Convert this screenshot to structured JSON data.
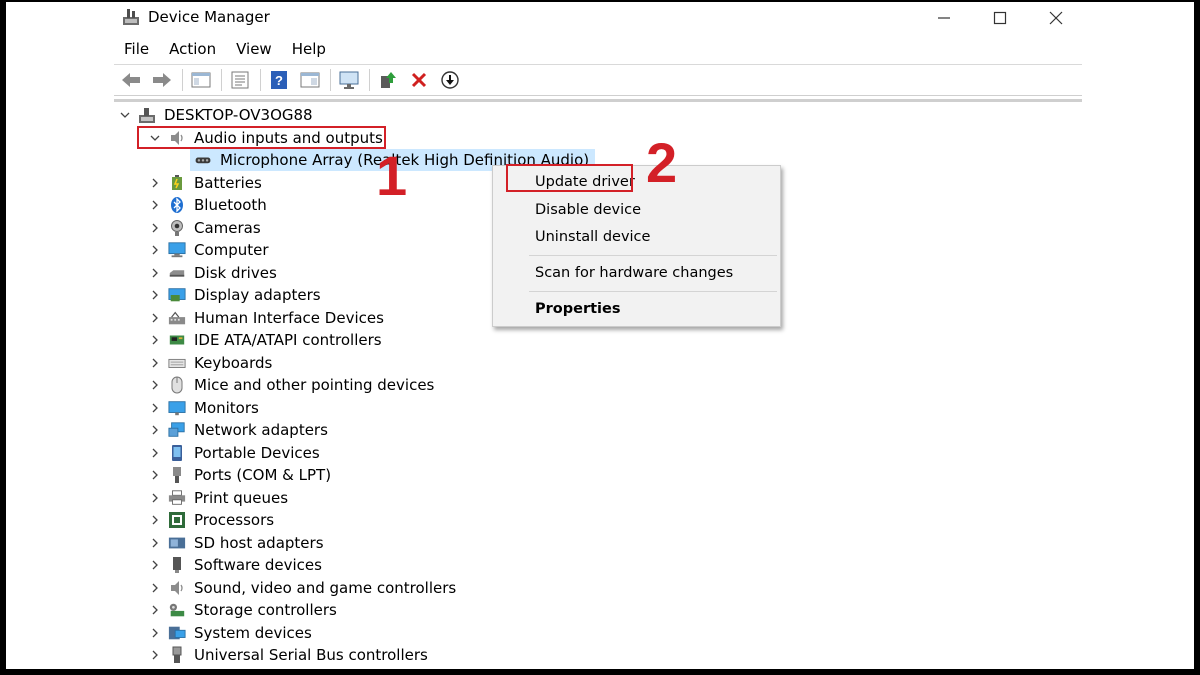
{
  "window": {
    "title": "Device Manager",
    "controls": [
      "minimize",
      "maximize",
      "close"
    ]
  },
  "menu": [
    "File",
    "Action",
    "View",
    "Help"
  ],
  "toolbar": {
    "icons": [
      "back-arrow-icon",
      "forward-arrow-icon",
      "show-hide-console-tree-icon",
      "properties-icon",
      "help-icon",
      "action-pane-icon",
      "monitor-icon",
      "update-driver-icon",
      "uninstall-icon",
      "download-icon"
    ]
  },
  "tree": {
    "root": "DESKTOP-OV3OG88",
    "expanded_category": "Audio inputs and outputs",
    "selected_device": "Microphone Array (Realtek High Definition Audio)",
    "categories": [
      "Batteries",
      "Bluetooth",
      "Cameras",
      "Computer",
      "Disk drives",
      "Display adapters",
      "Human Interface Devices",
      "IDE ATA/ATAPI controllers",
      "Keyboards",
      "Mice and other pointing devices",
      "Monitors",
      "Network adapters",
      "Portable Devices",
      "Ports (COM & LPT)",
      "Print queues",
      "Processors",
      "SD host adapters",
      "Software devices",
      "Sound, video and game controllers",
      "Storage controllers",
      "System devices",
      "Universal Serial Bus controllers"
    ]
  },
  "context_menu": {
    "update_driver": "Update driver",
    "disable_device": "Disable device",
    "uninstall_device": "Uninstall device",
    "scan": "Scan for hardware changes",
    "properties": "Properties"
  },
  "annotations": {
    "step1": "1",
    "step2": "2",
    "color": "#d32027"
  },
  "colors": {
    "selection": "#cce8ff",
    "menu_bg": "#f2f2f2"
  }
}
